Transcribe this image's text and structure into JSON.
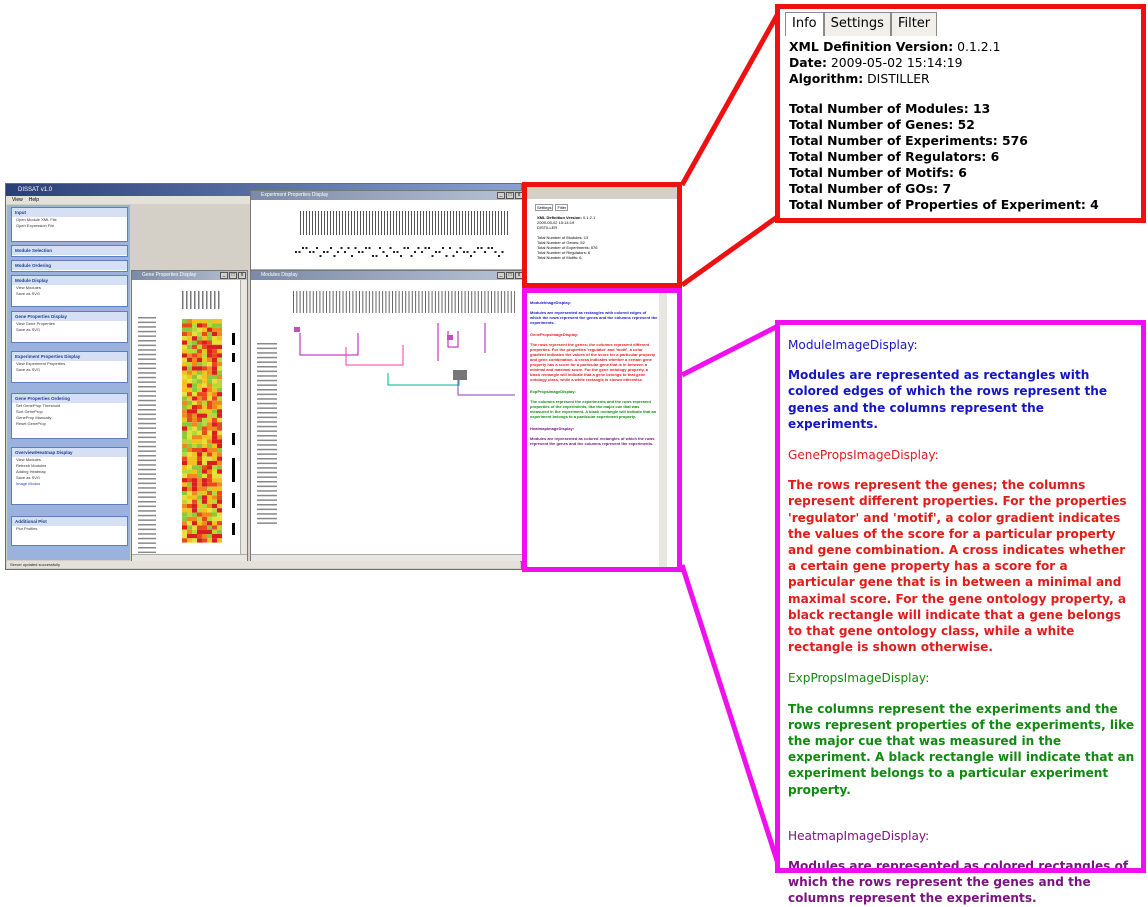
{
  "app": {
    "title": "DISSAT v1.0",
    "menu": [
      "View",
      "Help"
    ],
    "status": "Server updated successfully"
  },
  "sidebar": {
    "sections": [
      {
        "header": "Input",
        "items": [
          "Open Module XML File",
          "Open Expression File"
        ]
      },
      {
        "header": "Module Selection",
        "items": []
      },
      {
        "header": "Module Ordering",
        "items": []
      },
      {
        "header": "Module Display",
        "items": [
          "View Modules",
          "Save as SVG"
        ]
      },
      {
        "header": "Gene Properties Display",
        "items": [
          "View Gene Properties",
          "Save as SVG"
        ]
      },
      {
        "header": "Experiment Properties Display",
        "items": [
          "View Experiment Properties",
          "Save as SVG"
        ]
      },
      {
        "header": "Gene Properties Ordering",
        "items": [
          "Set GeneProp Threshold",
          "Sort GeneProp",
          "GeneProp Manually",
          "Reset GeneProp"
        ]
      },
      {
        "header": "Overview/Heatmap Display",
        "items": [
          "View Modules",
          "Refresh Modules",
          "Adding Heatmap",
          "Save as SVG",
          "Image Modus"
        ]
      },
      {
        "header": "Additional Plot",
        "items": [
          "Plot Profiles"
        ]
      }
    ]
  },
  "windows": {
    "experiment_props": "Experiment Properties Display",
    "gene_props": "Gene Properties Display",
    "modules": "Modules Display"
  },
  "info_panel": {
    "tabs": [
      "Info",
      "Settings",
      "Filter"
    ],
    "active_tab": "Info",
    "xml_version_label": "XML Definition Version:",
    "xml_version": "0.1.2.1",
    "date_label": "Date:",
    "date": "2009-05-02 15:14:19",
    "algorithm_label": "Algorithm:",
    "algorithm": "DISTILLER",
    "stats": [
      "Total Number of Modules: 13",
      "Total Number of Genes: 52",
      "Total Number of Experiments: 576",
      "Total Number of Regulators: 6",
      "Total Number of Motifs: 6",
      "Total Number of GOs: 7",
      "Total Number of Properties of Experiment: 4"
    ]
  },
  "description_panel": {
    "module_heading": "ModuleImageDisplay:",
    "module_text": "Modules are represented as rectangles with colored edges of which the rows represent the genes and the columns represent the experiments.",
    "geneprops_heading": "GenePropsImageDisplay:",
    "geneprops_text": "The rows represent the genes; the columns represent different properties. For the properties 'regulator' and 'motif', a color gradient indicates the values of the score for a particular property and gene combination. A cross indicates whether a certain gene property has a score for a particular gene that is in between a minimal and maximal score. For the gene ontology property, a black rectangle will indicate that a gene belongs to that gene ontology class, while a white rectangle is shown otherwise.",
    "expprops_heading": "ExpPropsImageDisplay:",
    "expprops_text": "The columns represent the experiments and the rows represent properties of the experiments, like the major cue that was measured in the experiment. A black rectangle will indicate that an experiment belongs to a particular experiment property.",
    "heatmap_heading": "HeatmapImageDisplay:",
    "heatmap_text": "Modules are represented as colored rectangles of which the rows represent the genes and the columns represent the experiments."
  },
  "colors": {
    "highlight_red": "#ee1111",
    "highlight_magenta": "#ee11ee",
    "module_blue": "#1515c8",
    "geneprops_red": "#e31b1b",
    "expprops_green": "#108a10",
    "heatmap_purple": "#7a1580"
  }
}
